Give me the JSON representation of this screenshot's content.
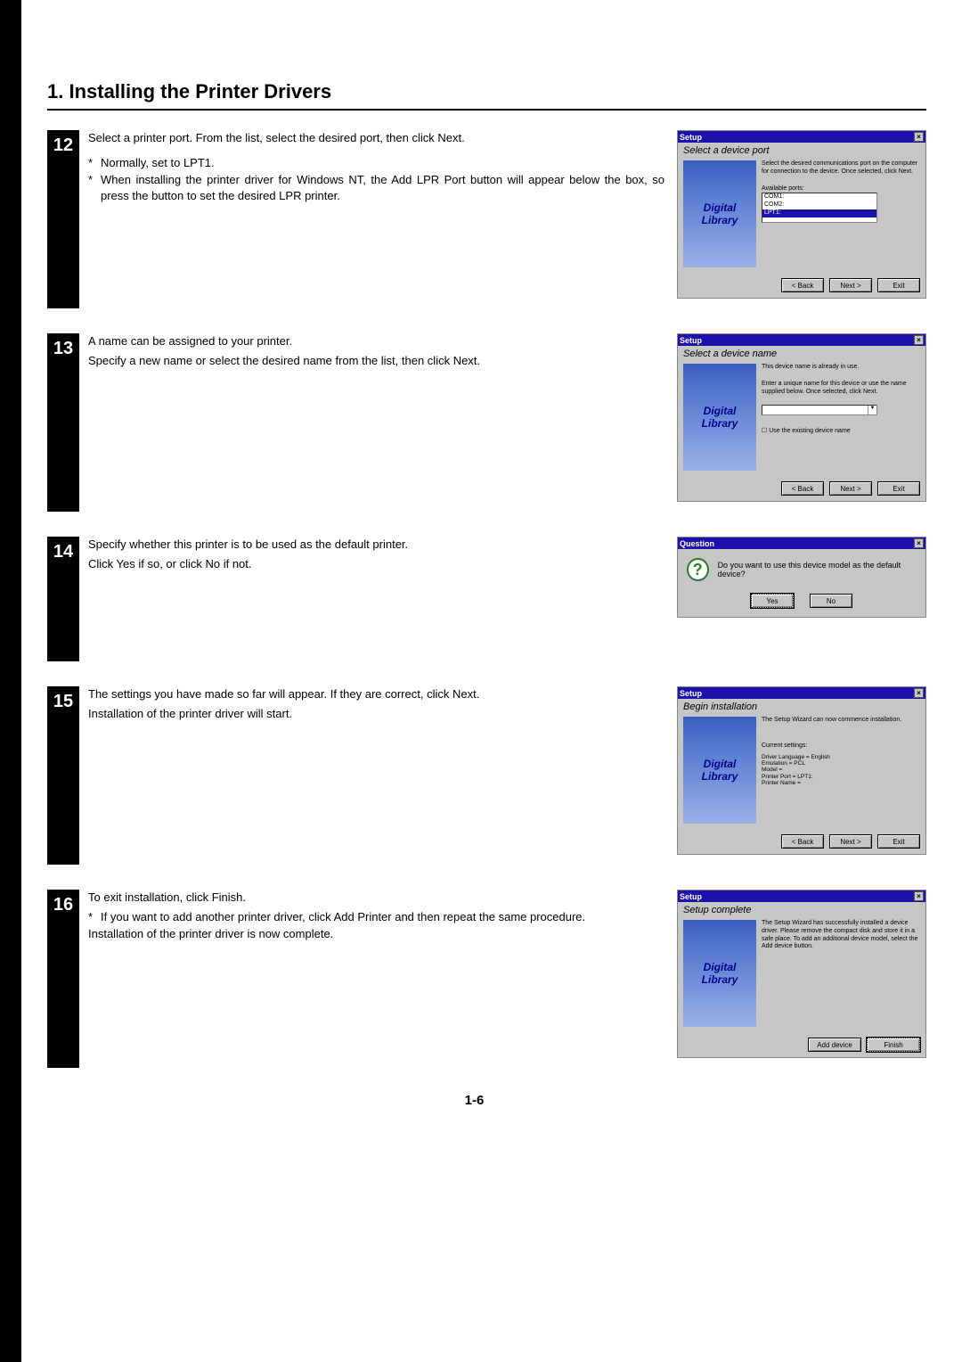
{
  "title": "1. Installing the Printer Drivers",
  "page_number": "1-6",
  "steps": [
    {
      "num": "12",
      "text1": "Select a printer port. From the list, select the desired port, then click Next.",
      "bullet1": "Normally, set to LPT1.",
      "bullet2": "When installing the printer driver for Windows NT, the Add LPR Port button will appear below the box, so press the button to set the desired LPR printer.",
      "shot": {
        "type": "port",
        "titlebar": "Setup",
        "subtitle": "Select a device port",
        "desc": "Select the desired communications port on the computer for connection to the device. Once selected, click Next.",
        "label": "Available ports:",
        "ports": [
          "COM1:",
          "COM2:"
        ],
        "port_sel": "LPT1:",
        "btn_back": "< Back",
        "btn_next": "Next >",
        "btn_exit": "Exit"
      }
    },
    {
      "num": "13",
      "text1": "A name can be assigned to your printer.",
      "text2": "Specify a new name or select the desired name from the list, then click Next.",
      "shot": {
        "type": "name",
        "titlebar": "Setup",
        "subtitle": "Select a device name",
        "desc1": "This device name is already in use.",
        "desc2": "Enter a unique name for this device or use the name supplied below. Once selected, click Next.",
        "checkbox": "Use the existing device name",
        "btn_back": "< Back",
        "btn_next": "Next >",
        "btn_exit": "Exit"
      }
    },
    {
      "num": "14",
      "text1": "Specify whether this printer is to be used as the default printer.",
      "text2": "Click Yes if so, or click No if not.",
      "shot": {
        "type": "question",
        "titlebar": "Question",
        "msg": "Do you want to use this device model as the default device?",
        "btn_yes": "Yes",
        "btn_no": "No"
      }
    },
    {
      "num": "15",
      "text1": "The settings you have made so far will appear. If they are correct, click Next.",
      "text2": "Installation of the printer driver will start.",
      "shot": {
        "type": "begin",
        "titlebar": "Setup",
        "subtitle": "Begin installation",
        "desc": "The Setup Wizard can now commence installation.",
        "label": "Current settings:",
        "lines": [
          "Driver Language = English",
          "Emulation = PCL",
          "Model =",
          "Printer Port = LPT1:",
          "Printer Name ="
        ],
        "btn_back": "< Back",
        "btn_next": "Next >",
        "btn_exit": "Exit"
      }
    },
    {
      "num": "16",
      "text1": "To exit installation, click Finish.",
      "bullet1": "If you want to add another printer driver, click Add Printer and then repeat the same procedure.",
      "text3": "Installation of the printer driver is now complete.",
      "shot": {
        "type": "complete",
        "titlebar": "Setup",
        "subtitle": "Setup complete",
        "desc": "The Setup Wizard has successfully installed a device driver. Please remove the compact disk and store it in a safe place. To add an additional device model, select the Add device button.",
        "btn_add": "Add device",
        "btn_finish": "Finish"
      }
    }
  ],
  "logo1": "Digital",
  "logo2": "Library"
}
